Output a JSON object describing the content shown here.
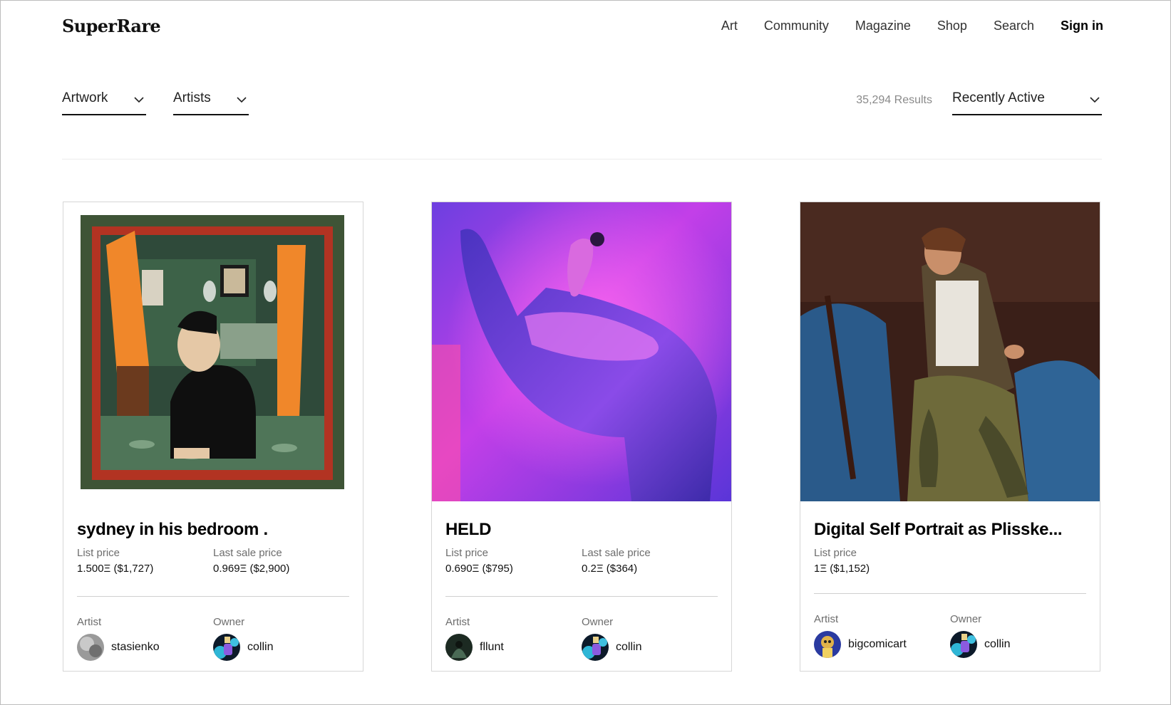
{
  "header": {
    "logo": "SuperRare",
    "nav": [
      "Art",
      "Community",
      "Magazine",
      "Shop",
      "Search"
    ],
    "sign_in": "Sign in"
  },
  "filters": {
    "artwork": "Artwork",
    "artists": "Artists",
    "results": "35,294 Results",
    "sort": "Recently Active"
  },
  "cards": [
    {
      "title": "sydney in his bedroom .",
      "list_price_label": "List price",
      "list_price": "1.500Ξ ($1,727)",
      "last_sale_label": "Last sale price",
      "last_sale": "0.969Ξ ($2,900)",
      "artist_label": "Artist",
      "artist": "stasienko",
      "owner_label": "Owner",
      "owner": "collin"
    },
    {
      "title": "HELD",
      "list_price_label": "List price",
      "list_price": "0.690Ξ ($795)",
      "last_sale_label": "Last sale price",
      "last_sale": "0.2Ξ ($364)",
      "artist_label": "Artist",
      "artist": "fllunt",
      "owner_label": "Owner",
      "owner": "collin"
    },
    {
      "title": "Digital Self Portrait as Plisske...",
      "list_price_label": "List price",
      "list_price": "1Ξ ($1,152)",
      "artist_label": "Artist",
      "artist": "bigcomicart",
      "owner_label": "Owner",
      "owner": "collin"
    }
  ],
  "colors": {
    "text": "#111111",
    "muted": "#6d6d6d",
    "border": "#d6d6d6",
    "results_gray": "#8a8a8a"
  }
}
